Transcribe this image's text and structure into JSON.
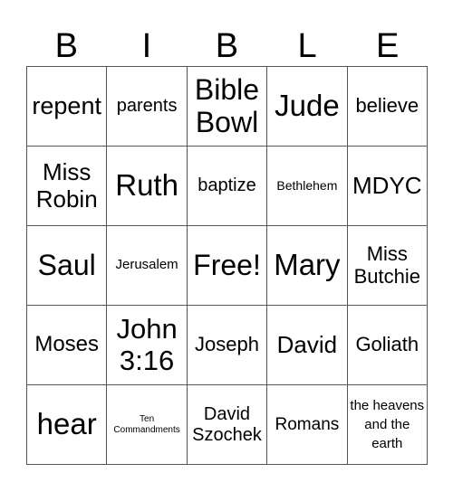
{
  "header": [
    "B",
    "I",
    "B",
    "L",
    "E"
  ],
  "cells": [
    [
      "repent",
      "parents",
      "Bible Bowl",
      "Jude",
      "believe"
    ],
    [
      "Miss Robin",
      "Ruth",
      "baptize",
      "Bethlehem",
      "MDYC"
    ],
    [
      "Saul",
      "Jerusalem",
      "Free!",
      "Mary",
      "Miss Butchie"
    ],
    [
      "Moses",
      "John 3:16",
      "Joseph",
      "David",
      "Goliath"
    ],
    [
      "hear",
      "Ten Commandments",
      "David Szochek",
      "Romans",
      "the heavens and the earth"
    ]
  ]
}
